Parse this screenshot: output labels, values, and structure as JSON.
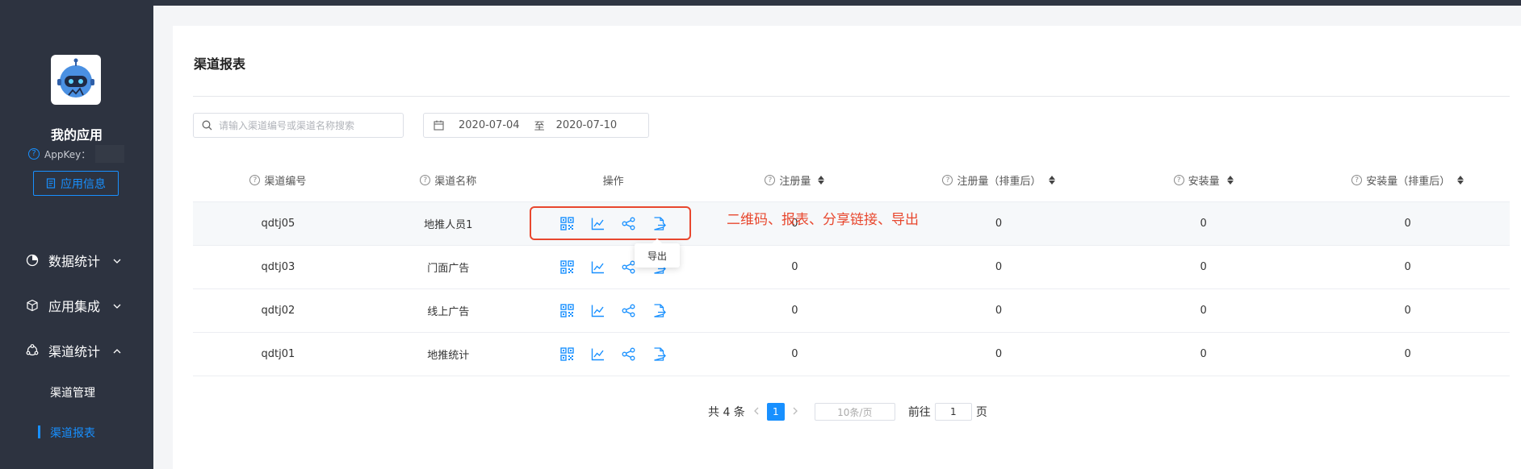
{
  "sidebar": {
    "app_name": "我的应用",
    "appkey_label": "AppKey：",
    "app_info_button": "应用信息",
    "menu": [
      {
        "label": "数据统计",
        "icon": "pie-chart-icon",
        "chevron": "chevron-down"
      },
      {
        "label": "应用集成",
        "icon": "cube-icon",
        "chevron": "chevron-down"
      },
      {
        "label": "渠道统计",
        "icon": "channel-icon",
        "chevron": "chevron-up"
      }
    ],
    "submenu": [
      {
        "label": "渠道管理",
        "active": false
      },
      {
        "label": "渠道报表",
        "active": true
      }
    ]
  },
  "main": {
    "title": "渠道报表",
    "search_placeholder": "请输入渠道编号或渠道名称搜索",
    "date_start": "2020-07-04",
    "date_sep": "至",
    "date_end": "2020-07-10",
    "columns": [
      "渠道编号",
      "渠道名称",
      "操作",
      "注册量",
      "注册量（排重后）",
      "安装量",
      "安装量（排重后）"
    ],
    "rows": [
      {
        "code": "qdtj05",
        "name": "地推人员1",
        "reg": "0",
        "reg_dedup": "0",
        "install": "0",
        "install_dedup": "0"
      },
      {
        "code": "qdtj03",
        "name": "门面广告",
        "reg": "0",
        "reg_dedup": "0",
        "install": "0",
        "install_dedup": "0"
      },
      {
        "code": "qdtj02",
        "name": "线上广告",
        "reg": "0",
        "reg_dedup": "0",
        "install": "0",
        "install_dedup": "0"
      },
      {
        "code": "qdtj01",
        "name": "地推统计",
        "reg": "0",
        "reg_dedup": "0",
        "install": "0",
        "install_dedup": "0"
      }
    ],
    "operations": [
      "qrcode-icon",
      "line-chart-icon",
      "share-icon",
      "export-icon"
    ],
    "annotation": "二维码、报表、分享链接、导出",
    "tooltip": "导出",
    "pagination": {
      "total": "共 4 条",
      "current_page": "1",
      "page_size": "10条/页",
      "goto_label": "前往",
      "goto_value": "1",
      "page_suffix": "页"
    }
  },
  "colors": {
    "sidebar_bg": "#2d3340",
    "accent": "#1890ff",
    "annotation": "#e8472e"
  }
}
